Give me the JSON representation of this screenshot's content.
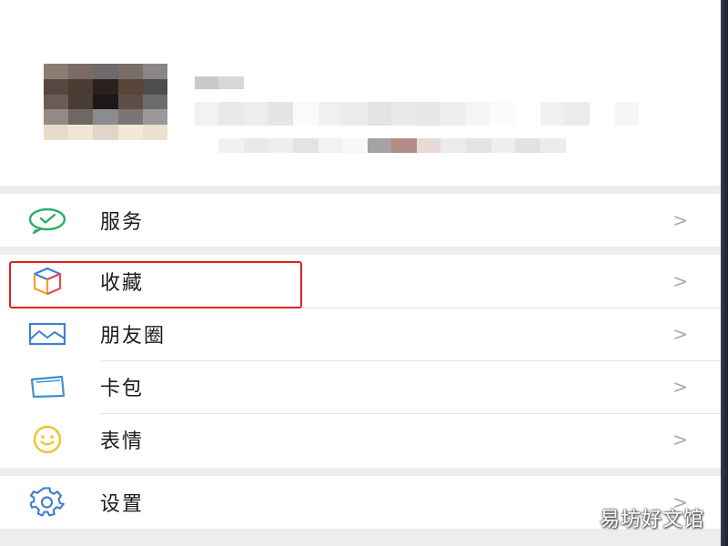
{
  "menu": {
    "services": {
      "label": "服务",
      "icon": "wechat-pay-icon",
      "arrow": ">"
    },
    "favorites": {
      "label": "收藏",
      "icon": "cube-icon",
      "arrow": ">"
    },
    "moments": {
      "label": "朋友圈",
      "icon": "photo-album-icon",
      "arrow": ">"
    },
    "cards": {
      "label": "卡包",
      "icon": "card-wallet-icon",
      "arrow": ">"
    },
    "stickers": {
      "label": "表情",
      "icon": "smiley-icon",
      "arrow": ">"
    },
    "settings": {
      "label": "设置",
      "icon": "gear-icon",
      "arrow": ">"
    }
  },
  "watermark": "易坊好文馆",
  "colors": {
    "highlight_border": "#e02020",
    "services_icon": "#2aae67",
    "favorites_icon_blue": "#3d7ce0",
    "favorites_icon_orange": "#f0a02a",
    "favorites_icon_red": "#e05050",
    "moments_icon": "#3f7fcf",
    "cards_icon": "#3f8fcf",
    "stickers_icon": "#f2c12e",
    "settings_icon": "#3f7fcf"
  }
}
